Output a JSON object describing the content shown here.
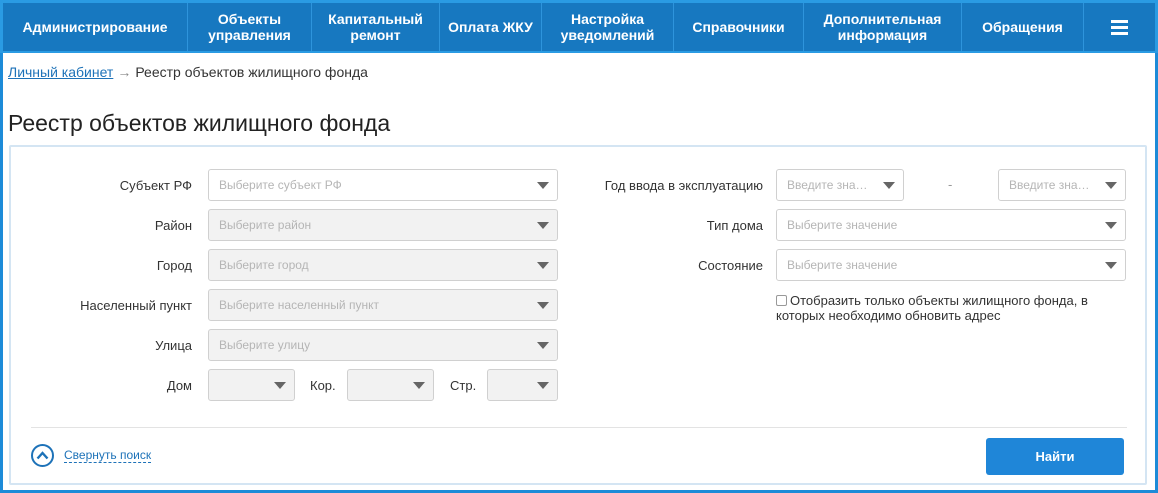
{
  "nav": {
    "items": [
      {
        "label": "Администрирование"
      },
      {
        "label": "Объекты\nуправления"
      },
      {
        "label": "Капитальный\nремонт"
      },
      {
        "label": "Оплата ЖКУ"
      },
      {
        "label": "Настройка\nуведомлений"
      },
      {
        "label": "Справочники"
      },
      {
        "label": "Дополнительная\nинформация"
      },
      {
        "label": "Обращения"
      }
    ],
    "menu_icon": "hamburger-icon"
  },
  "breadcrumb": {
    "link": "Личный кабинет",
    "separator": "→",
    "current": "Реестр объектов жилищного фонда"
  },
  "page_title": "Реестр объектов жилищного фонда",
  "filters": {
    "subject": {
      "label": "Субъект РФ",
      "placeholder": "Выберите субъект РФ"
    },
    "district": {
      "label": "Район",
      "placeholder": "Выберите район"
    },
    "city": {
      "label": "Город",
      "placeholder": "Выберите город"
    },
    "settlement": {
      "label": "Населенный пункт",
      "placeholder": "Выберите населенный пункт"
    },
    "street": {
      "label": "Улица",
      "placeholder": "Выберите улицу"
    },
    "house": {
      "label": "Дом",
      "placeholder": ""
    },
    "building": {
      "label": "Кор.",
      "placeholder": ""
    },
    "structure": {
      "label": "Стр.",
      "placeholder": ""
    },
    "year": {
      "label": "Год ввода в эксплуатацию",
      "from_placeholder": "Введите зна…",
      "separator": "-",
      "to_placeholder": "Введите зна…"
    },
    "house_type": {
      "label": "Тип дома",
      "placeholder": "Выберите значение"
    },
    "state": {
      "label": "Состояние",
      "placeholder": "Выберите значение"
    },
    "only_update_address": {
      "label": "Отобразить только объекты жилищного фонда, в которых необходимо обновить адрес",
      "checked": false
    }
  },
  "actions": {
    "collapse_label": "Свернуть поиск",
    "find_label": "Найти"
  },
  "colors": {
    "nav_bg": "#1778c0",
    "accent": "#1f86d8",
    "link": "#1d72b8"
  }
}
